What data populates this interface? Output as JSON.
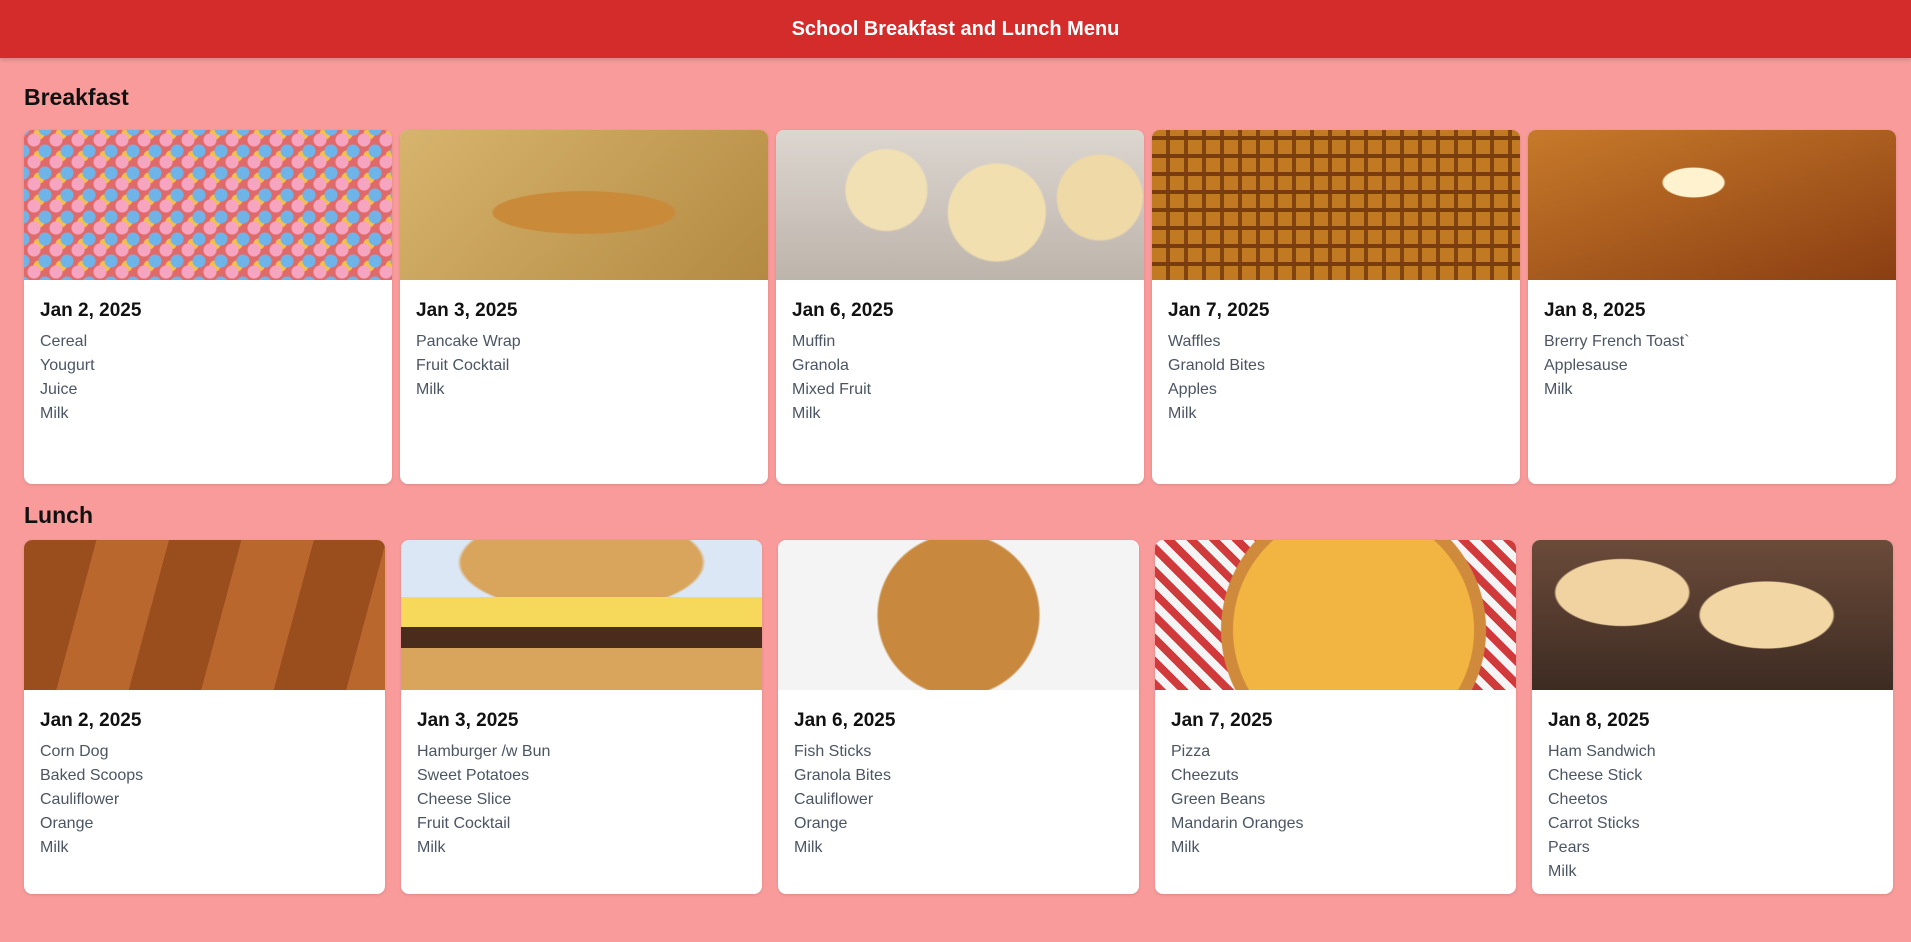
{
  "header": {
    "title": "School Breakfast and Lunch Menu"
  },
  "breakfast": {
    "title": "Breakfast",
    "cards": [
      {
        "date": "Jan 2, 2025",
        "items": [
          "Cereal",
          "Yougurt",
          "Juice",
          "Milk"
        ]
      },
      {
        "date": "Jan 3, 2025",
        "items": [
          "Pancake Wrap",
          "Fruit Cocktail",
          "Milk"
        ]
      },
      {
        "date": "Jan 6, 2025",
        "items": [
          "Muffin",
          "Granola",
          "Mixed Fruit",
          "Milk"
        ]
      },
      {
        "date": "Jan 7, 2025",
        "items": [
          "Waffles",
          "Granold Bites",
          "Apples",
          "Milk"
        ]
      },
      {
        "date": "Jan 8, 2025",
        "items": [
          "Brerry French Toast`",
          "Applesause",
          "Milk"
        ]
      }
    ]
  },
  "lunch": {
    "title": "Lunch",
    "cards": [
      {
        "date": "Jan 2, 2025",
        "items": [
          "Corn Dog",
          "Baked Scoops",
          "Cauliflower",
          "Orange",
          "Milk"
        ]
      },
      {
        "date": "Jan 3, 2025",
        "items": [
          "Hamburger /w Bun",
          "Sweet Potatoes",
          "Cheese Slice",
          "Fruit Cocktail",
          "Milk"
        ]
      },
      {
        "date": "Jan 6, 2025",
        "items": [
          "Fish Sticks",
          "Granola Bites",
          "Cauliflower",
          "Orange",
          "Milk"
        ]
      },
      {
        "date": "Jan 7, 2025",
        "items": [
          "Pizza",
          "Cheezuts",
          "Green Beans",
          "Mandarin Oranges",
          "Milk"
        ]
      },
      {
        "date": "Jan 8, 2025",
        "items": [
          "Ham Sandwich",
          "Cheese Stick",
          "Cheetos",
          "Carrot Sticks",
          "Pears",
          "Milk"
        ]
      }
    ]
  }
}
